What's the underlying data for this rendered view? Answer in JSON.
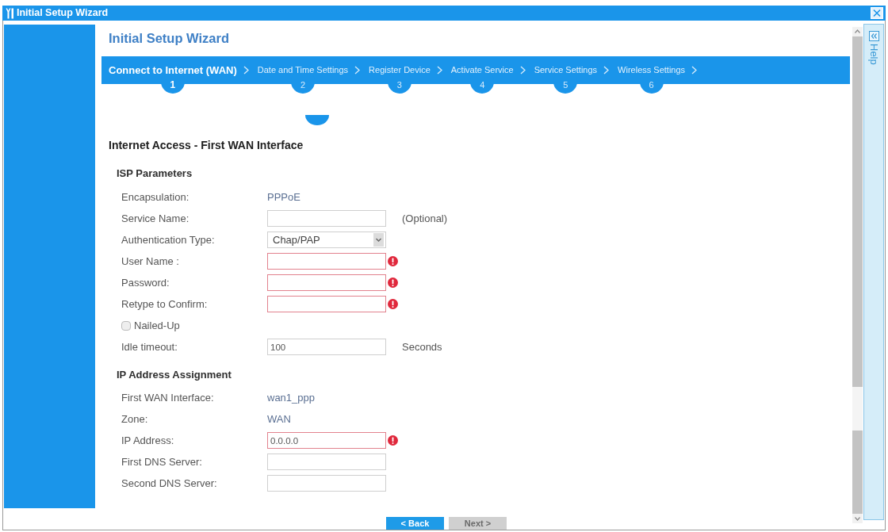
{
  "window": {
    "title": "Initial Setup Wizard"
  },
  "page_title": "Initial Setup Wizard",
  "steps": [
    {
      "label": "Connect to Internet (WAN)",
      "number": "1",
      "selected": true
    },
    {
      "label": "Date and Time Settings",
      "number": "2",
      "selected": false
    },
    {
      "label": "Register Device",
      "number": "3",
      "selected": false
    },
    {
      "label": "Activate Service",
      "number": "4",
      "selected": false
    },
    {
      "label": "Service Settings",
      "number": "5",
      "selected": false
    },
    {
      "label": "Wireless Settings",
      "number": "6",
      "selected": false
    }
  ],
  "section_title": "Internet Access - First WAN Interface",
  "groups": [
    {
      "title": "ISP Parameters",
      "rows": [
        {
          "kind": "text",
          "label": "Encapsulation:",
          "value": "PPPoE"
        },
        {
          "kind": "input",
          "label": "Service Name:",
          "error": false,
          "suffix": "(Optional)"
        },
        {
          "kind": "select",
          "label": "Authentication Type:",
          "value": "Chap/PAP"
        },
        {
          "kind": "input",
          "label": "User Name :",
          "error": true
        },
        {
          "kind": "input",
          "label": "Password:",
          "error": true
        },
        {
          "kind": "input",
          "label": "Retype to Confirm:",
          "error": true
        },
        {
          "kind": "checkbox",
          "label": "Nailed-Up",
          "checked": false
        },
        {
          "kind": "input",
          "label": "Idle timeout:",
          "value": "100",
          "error": false,
          "suffix": "Seconds"
        }
      ]
    },
    {
      "title": "IP Address Assignment",
      "rows": [
        {
          "kind": "text",
          "label": "First WAN Interface:",
          "value": "wan1_ppp"
        },
        {
          "kind": "text",
          "label": "Zone:",
          "value": "WAN"
        },
        {
          "kind": "input",
          "label": "IP Address:",
          "value": "0.0.0.0",
          "error": true
        },
        {
          "kind": "input",
          "label": "First DNS Server:",
          "error": false
        },
        {
          "kind": "input",
          "label": "Second DNS Server:",
          "error": false
        }
      ]
    }
  ],
  "buttons": [
    {
      "label": "< Back",
      "disabled": false
    },
    {
      "label": "Next >",
      "disabled": true
    }
  ],
  "help": {
    "label": "Help"
  }
}
